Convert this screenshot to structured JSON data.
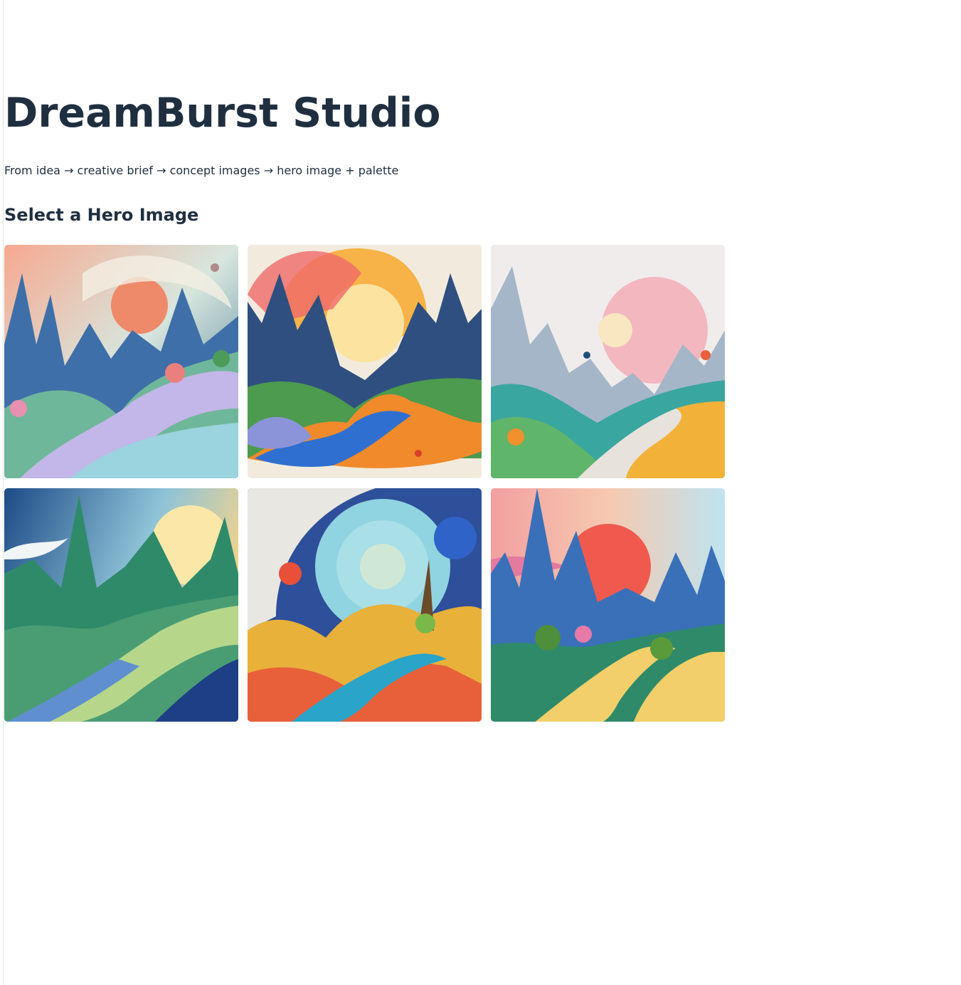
{
  "header": {
    "title": "DreamBurst Studio",
    "subtitle": "From idea → creative brief → concept images → hero image + palette"
  },
  "gallery": {
    "heading": "Select a Hero Image",
    "images": [
      {
        "colors": {
          "sky": "#f3c0a2",
          "sun": "#ee8a6a",
          "hill": "#5aa98c",
          "river": "#c3b6e8",
          "accent": "#2f5f9e"
        }
      },
      {
        "colors": {
          "sky": "#f2ebdd",
          "sun": "#f7b347",
          "hill": "#3f8a4e",
          "river": "#2f6fd0",
          "accent": "#f08a2a"
        }
      },
      {
        "colors": {
          "sky": "#f1ecec",
          "sun": "#f3b7c0",
          "hill": "#3aa6a0",
          "river": "#e8e2dc",
          "accent": "#f2b23a"
        }
      },
      {
        "colors": {
          "sky": "#3f79b8",
          "sun": "#fbe8a8",
          "hill": "#2f8a6a",
          "river": "#b6d78a",
          "accent": "#1d3f86"
        }
      },
      {
        "colors": {
          "sky": "#2e4f9a",
          "sun": "#cfe8d6",
          "hill": "#e8b13a",
          "river": "#e8603a",
          "accent": "#2aa4c8"
        }
      },
      {
        "colors": {
          "sky": "#f2c0b6",
          "sun": "#f05a4e",
          "hill": "#2f8a6a",
          "river": "#f2cf6a",
          "accent": "#3a70b8"
        }
      }
    ]
  }
}
